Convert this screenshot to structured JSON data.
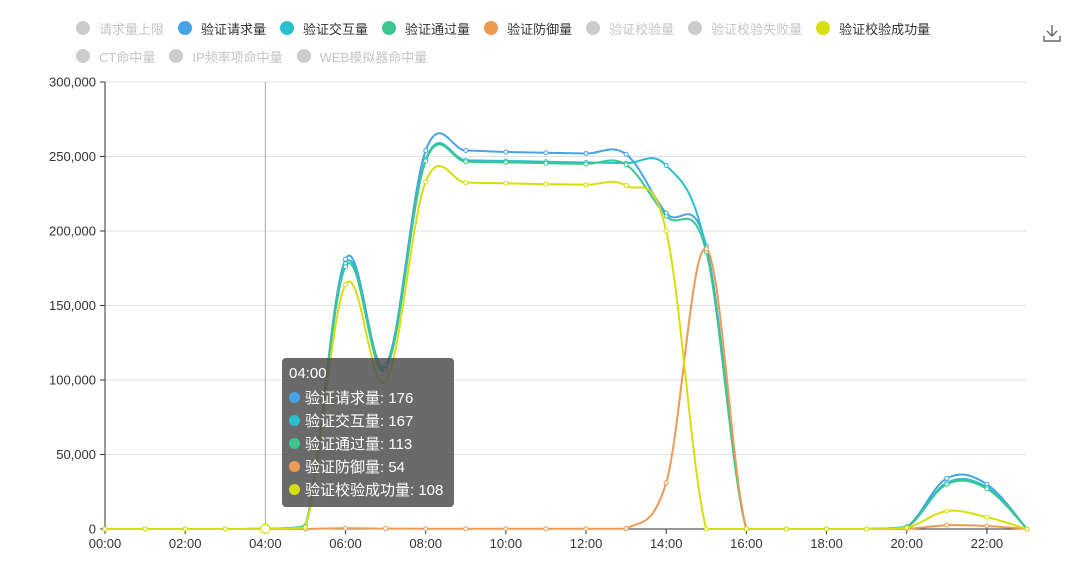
{
  "legend": {
    "row1": [
      {
        "label": "请求量上限",
        "color": "#cccccc",
        "active": false
      },
      {
        "label": "验证请求量",
        "color": "#46a3e8",
        "active": true
      },
      {
        "label": "验证交互量",
        "color": "#29bfcf",
        "active": true
      },
      {
        "label": "验证通过量",
        "color": "#3cc78e",
        "active": true
      },
      {
        "label": "验证防御量",
        "color": "#ef9a52",
        "active": true
      },
      {
        "label": "验证校验量",
        "color": "#cccccc",
        "active": false
      },
      {
        "label": "验证校验失败量",
        "color": "#cccccc",
        "active": false
      },
      {
        "label": "验证校验成功量",
        "color": "#d7de0f",
        "active": true
      }
    ],
    "row2": [
      {
        "label": "CT命中量",
        "color": "#cccccc",
        "active": false
      },
      {
        "label": "IP频率项命中量",
        "color": "#cccccc",
        "active": false
      },
      {
        "label": "WEB模拟器命中量",
        "color": "#cccccc",
        "active": false
      }
    ]
  },
  "toolbar": {
    "download_icon": "download-icon"
  },
  "tooltip": {
    "time": "04:00",
    "rows": [
      {
        "text": "验证请求量: 176",
        "color": "#46a3e8"
      },
      {
        "text": "验证交互量: 167",
        "color": "#29bfcf"
      },
      {
        "text": "验证通过量: 113",
        "color": "#3cc78e"
      },
      {
        "text": "验证防御量: 54",
        "color": "#ef9a52"
      },
      {
        "text": "验证校验成功量: 108",
        "color": "#d7de0f"
      }
    ]
  },
  "chart_data": {
    "type": "line",
    "x": [
      "00:00",
      "01:00",
      "02:00",
      "03:00",
      "04:00",
      "05:00",
      "06:00",
      "07:00",
      "08:00",
      "09:00",
      "10:00",
      "11:00",
      "12:00",
      "13:00",
      "14:00",
      "15:00",
      "16:00",
      "17:00",
      "18:00",
      "19:00",
      "20:00",
      "21:00",
      "22:00",
      "23:00"
    ],
    "x_tick_labels": [
      "00:00",
      "02:00",
      "04:00",
      "06:00",
      "08:00",
      "10:00",
      "12:00",
      "14:00",
      "16:00",
      "18:00",
      "20:00",
      "22:00"
    ],
    "y_tick_labels": [
      "0",
      "50,000",
      "100,000",
      "150,000",
      "200,000",
      "250,000",
      "300,000"
    ],
    "ylim": [
      0,
      300000
    ],
    "grid": true,
    "highlight_x": "04:00",
    "series": [
      {
        "name": "验证请求量",
        "color": "#46a3e8",
        "values": [
          0,
          0,
          0,
          0,
          176,
          2000,
          181000,
          110000,
          254000,
          254000,
          253000,
          252500,
          252000,
          251500,
          212000,
          190000,
          0,
          0,
          0,
          0,
          1500,
          34000,
          30000,
          0
        ]
      },
      {
        "name": "验证交互量",
        "color": "#29bfcf",
        "values": [
          0,
          0,
          0,
          0,
          167,
          1900,
          178000,
          108000,
          248000,
          247500,
          247000,
          246500,
          246000,
          245500,
          244000,
          188000,
          0,
          0,
          0,
          0,
          1400,
          31000,
          28000,
          0
        ]
      },
      {
        "name": "验证通过量",
        "color": "#3cc78e",
        "values": [
          0,
          0,
          0,
          0,
          113,
          1500,
          176000,
          107000,
          247000,
          246500,
          246000,
          245500,
          245000,
          244500,
          210000,
          186000,
          0,
          0,
          0,
          0,
          1200,
          30000,
          27000,
          0
        ]
      },
      {
        "name": "验证防御量",
        "color": "#ef9a52",
        "values": [
          0,
          0,
          0,
          0,
          54,
          100,
          500,
          300,
          200,
          200,
          200,
          200,
          200,
          300,
          31000,
          188000,
          0,
          0,
          0,
          0,
          100,
          2500,
          2000,
          0
        ]
      },
      {
        "name": "验证校验成功量",
        "color": "#d7de0f",
        "values": [
          0,
          0,
          0,
          0,
          108,
          1200,
          164000,
          99000,
          233000,
          232500,
          232000,
          231500,
          231000,
          230500,
          200000,
          0,
          0,
          0,
          0,
          0,
          800,
          12000,
          8000,
          0
        ]
      }
    ]
  }
}
